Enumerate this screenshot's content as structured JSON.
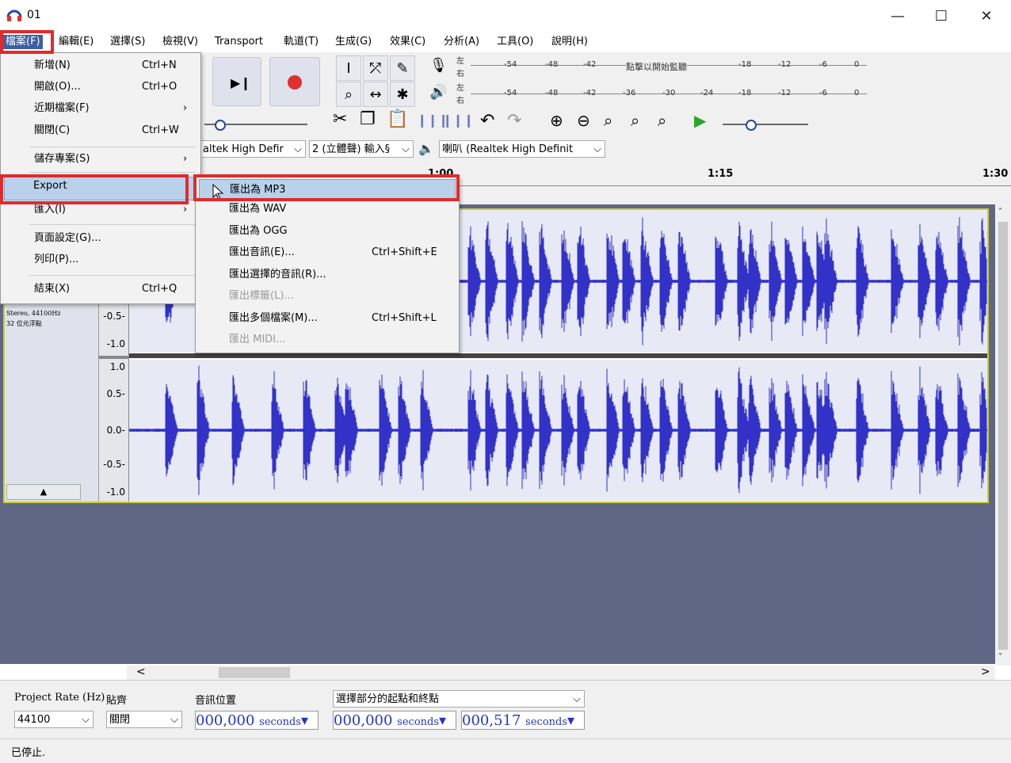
{
  "window": {
    "title": "01",
    "minimize": "—",
    "maximize": "☐",
    "close": "✕"
  },
  "menubar": [
    "檔案(F)",
    "編輯(E)",
    "選擇(S)",
    "檢視(V)",
    "Transport",
    "軌道(T)",
    "生成(G)",
    "效果(C)",
    "分析(A)",
    "工具(O)",
    "說明(H)"
  ],
  "file_menu": {
    "items": [
      {
        "label": "新增(N)",
        "shortcut": "Ctrl+N"
      },
      {
        "label": "開啟(O)...",
        "shortcut": "Ctrl+O"
      },
      {
        "label": "近期檔案(F)",
        "arrow": "›"
      },
      {
        "label": "關閉(C)",
        "shortcut": "Ctrl+W"
      },
      {
        "label": "儲存專案(S)",
        "arrow": "›"
      },
      {
        "label": "Export"
      },
      {
        "label": "匯入(I)",
        "arrow": "›"
      },
      {
        "label": "頁面設定(G)..."
      },
      {
        "label": "列印(P)..."
      },
      {
        "label": "結束(X)",
        "shortcut": "Ctrl+Q"
      }
    ]
  },
  "export_menu": {
    "items": [
      {
        "label": "匯出為 MP3"
      },
      {
        "label": "匯出為 WAV"
      },
      {
        "label": "匯出為 OGG"
      },
      {
        "label": "匯出音訊(E)...",
        "shortcut": "Ctrl+Shift+E"
      },
      {
        "label": "匯出選擇的音訊(R)..."
      },
      {
        "label": "匯出標籤(L)..."
      },
      {
        "label": "匯出多個檔案(M)...",
        "shortcut": "Ctrl+Shift+L"
      },
      {
        "label": "匯出 MIDI..."
      }
    ]
  },
  "meters": {
    "record": {
      "lr": [
        "左",
        "右"
      ],
      "ticks": [
        "-54",
        "-48",
        "-42",
        "點擊以開始監聽",
        "-18",
        "-12",
        "-6",
        "0"
      ]
    },
    "play": {
      "lr": [
        "左",
        "右"
      ],
      "ticks": [
        "-54",
        "-48",
        "-42",
        "-36",
        "-30",
        "-24",
        "-18",
        "-12",
        "-6",
        "0"
      ]
    }
  },
  "device": {
    "input_device": "altek High Defir",
    "channels": "2 (立體聲) 輸入§",
    "output_device": "喇叭 (Realtek High Definit"
  },
  "ruler": {
    "labels": [
      "1:00",
      "1:15",
      "1:30"
    ]
  },
  "track": {
    "info_line1": "Stereo, 44100Hz",
    "info_line2": "32 位元浮點",
    "scale_top": [
      "-0.5-",
      "-1.0"
    ],
    "scale_bottom": [
      "1.0",
      "0.5-",
      "0.0-",
      "-0.5-",
      "-1.0"
    ],
    "collapse": "▲"
  },
  "selection_bar": {
    "rate_label": "Project Rate (Hz)",
    "rate_value": "44100",
    "snap_label": "貼齊",
    "snap_value": "關閉",
    "pos_label": "音訊位置",
    "pos_value": "000,000",
    "sel_label": "選擇部分的起點和終點",
    "start_value": "000,000",
    "end_value": "000,517",
    "unit": "seconds"
  },
  "status": "已停止.",
  "scroll": {
    "left": "<",
    "right": ">"
  },
  "colors": {
    "accent": "#e12b2b",
    "wave": "#3232c8",
    "menu_highlight": "#b9d1ea"
  }
}
